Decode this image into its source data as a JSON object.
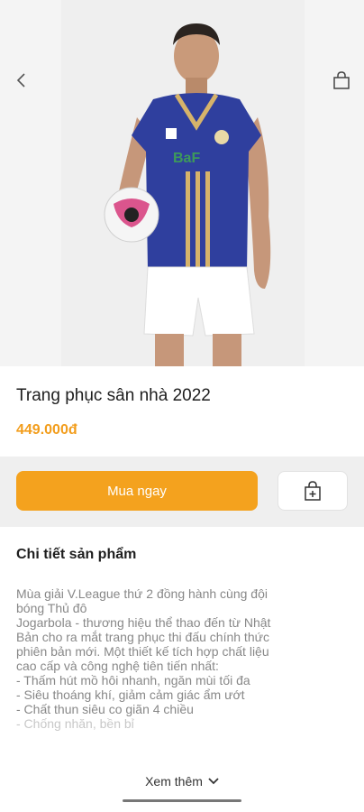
{
  "header": {
    "back_icon": "chevron-left-icon",
    "bag_icon": "shopping-bag-icon"
  },
  "product": {
    "image_desc": "player in blue home jersey holding football",
    "title": "Trang phục sân nhà 2022",
    "price": "449.000đ"
  },
  "actions": {
    "buy_label": "Mua ngay",
    "cart_icon": "add-to-cart-icon"
  },
  "details": {
    "heading": "Chi tiết sản phẩm",
    "lines": [
      "Mùa giải V.League thứ 2 đồng hành cùng đội",
      "bóng Thủ đô",
      "Jogarbola - thương hiệu thể thao đến từ Nhật",
      "Bản cho ra mắt trang phục thi đấu chính thức",
      "phiên bản mới. Một thiết kế tích hợp chất liệu",
      "cao cấp và công nghệ tiên tiến nhất:",
      "- Thấm hút mồ hôi nhanh, ngăn mùi tối đa",
      "- Siêu thoáng khí, giảm cảm giác ẩm ướt",
      "- Chất thun siêu co giãn 4 chiều",
      "- Chống nhăn, bền bỉ"
    ],
    "see_more": "Xem thêm"
  },
  "colors": {
    "accent": "#f4a21e",
    "price": "#f29d1c"
  }
}
